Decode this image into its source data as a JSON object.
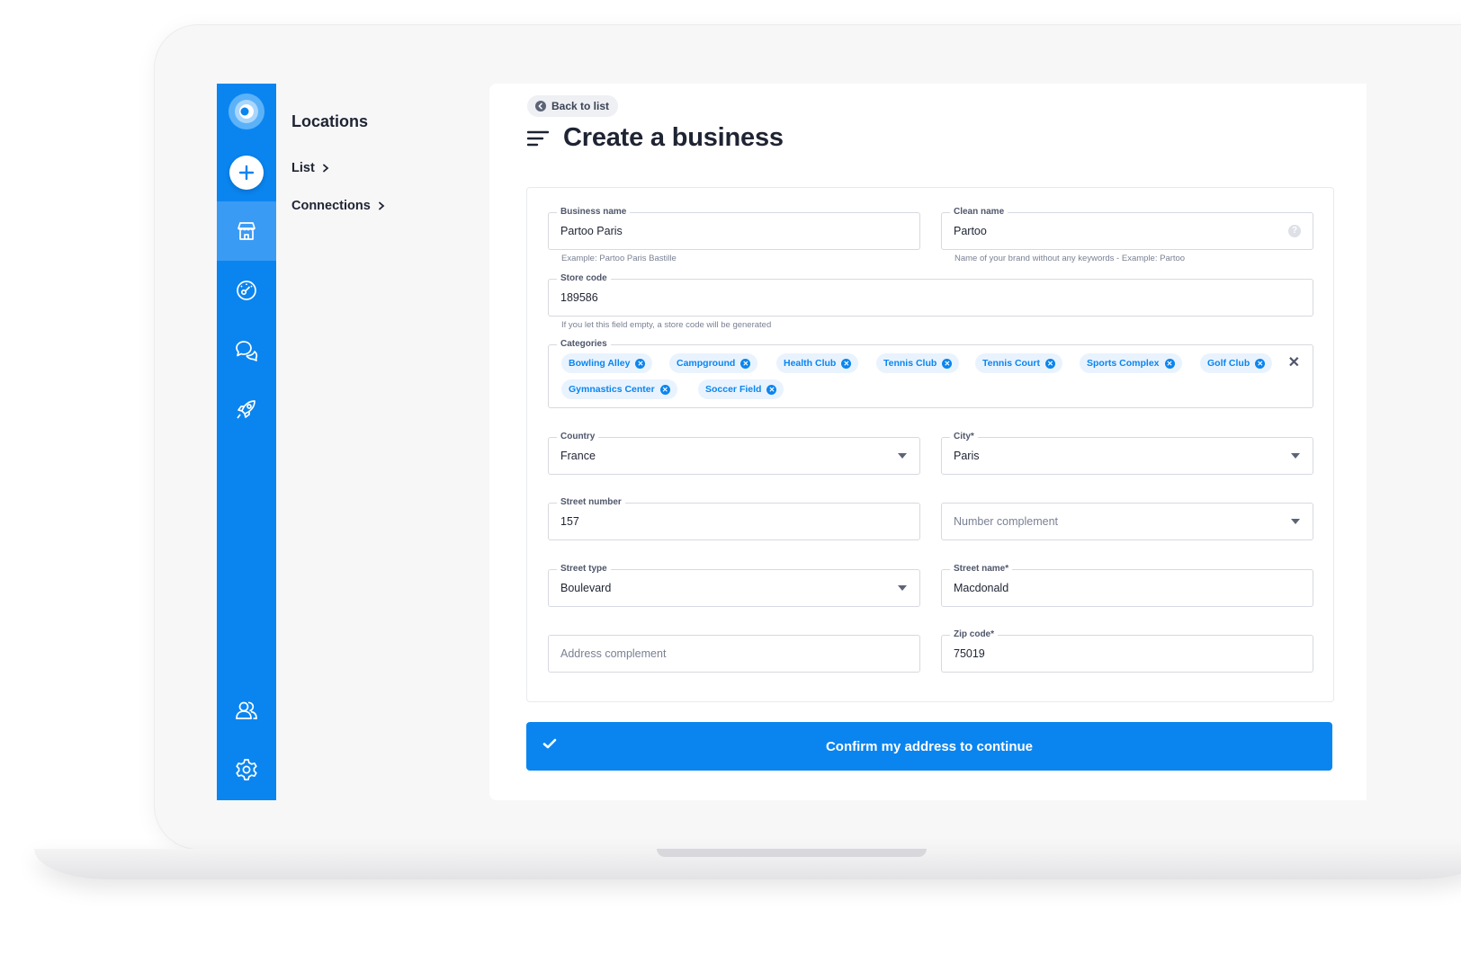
{
  "colors": {
    "primary": "#0a85f0",
    "rail_active": "#3a9bf5",
    "chip_bg": "#e9f3fe",
    "text_dark": "#1f2433"
  },
  "rail": {
    "logo_icon": "partoo-logo",
    "add_icon": "plus-icon",
    "items": [
      {
        "icon": "store-icon",
        "active": true
      },
      {
        "icon": "analytics-icon",
        "active": false
      },
      {
        "icon": "messages-icon",
        "active": false
      },
      {
        "icon": "rocket-icon",
        "active": false
      },
      {
        "icon": "users-icon",
        "active": false
      },
      {
        "icon": "gear-icon",
        "active": false
      }
    ]
  },
  "subnav": {
    "title": "Locations",
    "links": [
      {
        "label": "List"
      },
      {
        "label": "Connections"
      }
    ]
  },
  "header": {
    "back_label": "Back to list",
    "title": "Create a business"
  },
  "form": {
    "business_name": {
      "label": "Business name",
      "value": "Partoo Paris",
      "hint": "Example: Partoo Paris Bastille"
    },
    "clean_name": {
      "label": "Clean name",
      "value": "Partoo",
      "hint": "Name of your brand without any keywords - Example: Partoo",
      "help": "?"
    },
    "store_code": {
      "label": "Store code",
      "value": "189586",
      "hint": "If you let this field empty, a store code will be generated"
    },
    "categories": {
      "label": "Categories",
      "clear": "✕",
      "items": [
        "Bowling Alley",
        "Campground",
        "Health Club",
        "Tennis Club",
        "Tennis Court",
        "Sports Complex",
        "Golf Club",
        "Gymnastics Center",
        "Soccer Field"
      ]
    },
    "country": {
      "label": "Country",
      "value": "France"
    },
    "city": {
      "label": "City*",
      "value": "Paris"
    },
    "street_number": {
      "label": "Street number",
      "value": "157"
    },
    "number_complement": {
      "placeholder": "Number complement"
    },
    "street_type": {
      "label": "Street type",
      "value": "Boulevard"
    },
    "street_name": {
      "label": "Street name*",
      "value": "Macdonald"
    },
    "address_complement": {
      "placeholder": "Address complement"
    },
    "zip_code": {
      "label": "Zip code*",
      "value": "75019"
    }
  },
  "cta": {
    "label": "Confirm my address to continue"
  }
}
